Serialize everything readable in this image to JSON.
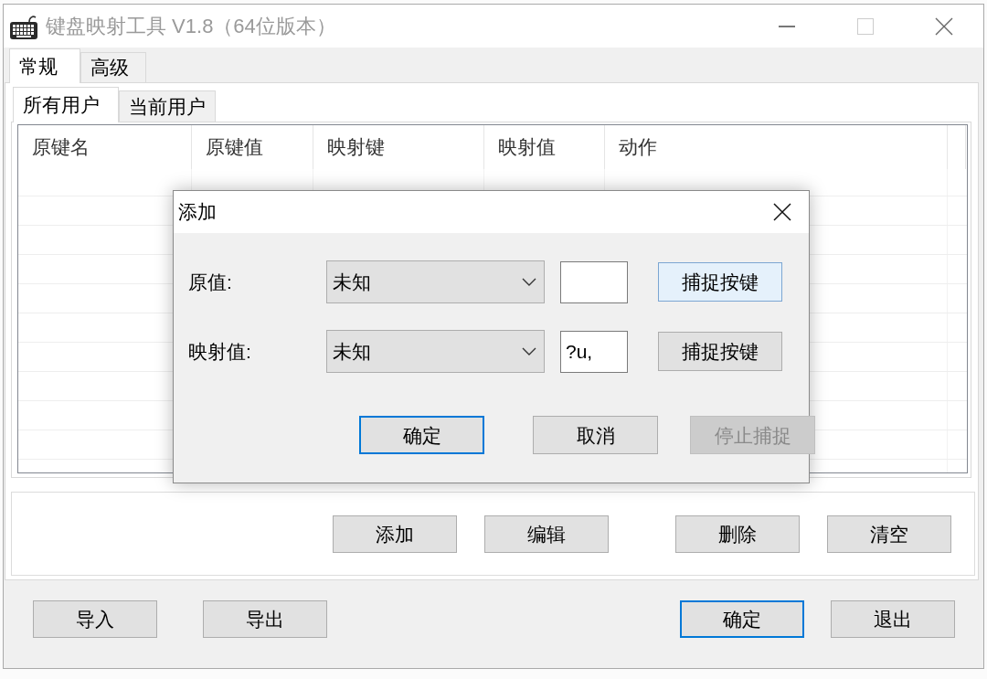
{
  "window": {
    "title": "键盘映射工具 V1.8（64位版本）",
    "active": false
  },
  "tabs": [
    {
      "label": "常规",
      "selected": true
    },
    {
      "label": "高级",
      "selected": false
    }
  ],
  "sub_tabs": [
    {
      "label": "所有用户",
      "selected": true
    },
    {
      "label": "当前用户",
      "selected": false
    }
  ],
  "table": {
    "columns": [
      "原键名",
      "原键值",
      "映射键",
      "映射值",
      "动作"
    ]
  },
  "list_buttons": [
    "添加",
    "编辑",
    "删除",
    "清空"
  ],
  "footer_buttons": [
    {
      "label": "导入",
      "default": false
    },
    {
      "label": "导出",
      "default": false
    },
    {
      "label": "确定",
      "default": true
    },
    {
      "label": "退出",
      "default": false
    }
  ],
  "dialog": {
    "title": "添加",
    "rows": [
      {
        "label": "原值:",
        "key": "未知",
        "capture_button": {
          "label": "捕捉按键",
          "hovered": true
        }
      },
      {
        "label": "映射值:",
        "key": "未知",
        "code": "?u,",
        "capture_button": {
          "label": "捕捉按键",
          "hovered": false
        }
      }
    ],
    "buttons": [
      {
        "label": "确定",
        "default": true,
        "disabled": false
      },
      {
        "label": "取消",
        "default": false,
        "disabled": false
      },
      {
        "label": "停止捕捉",
        "default": false,
        "disabled": true
      }
    ]
  }
}
